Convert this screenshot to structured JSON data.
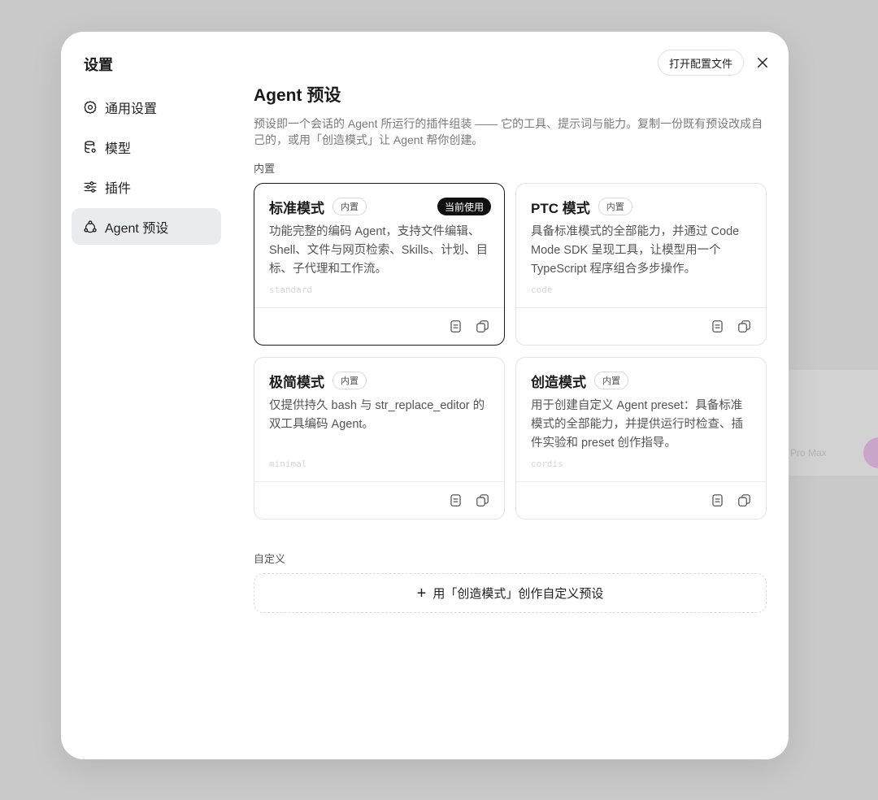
{
  "background": {
    "model_label": "Pro Max"
  },
  "sidebar": {
    "title": "设置",
    "items": [
      {
        "label": "通用设置",
        "icon": "gear-icon",
        "active": false
      },
      {
        "label": "模型",
        "icon": "database-icon",
        "active": false
      },
      {
        "label": "插件",
        "icon": "sliders-icon",
        "active": false
      },
      {
        "label": "Agent 预设",
        "icon": "agent-icon",
        "active": true
      }
    ]
  },
  "header": {
    "open_config_label": "打开配置文件",
    "close_icon": "close-icon"
  },
  "main": {
    "title": "Agent 预设",
    "description": "预设即一个会话的 Agent 所运行的插件组装 —— 它的工具、提示词与能力。复制一份既有预设改成自己的，或用「创造模式」让 Agent 帮你创建。",
    "builtin_label": "内置",
    "custom_label": "自定义",
    "create_button_label": "用「创造模式」创作自定义预设",
    "presets": [
      {
        "title": "标准模式",
        "tag": "内置",
        "badge": "当前使用",
        "description": "功能完整的编码 Agent，支持文件编辑、Shell、文件与网页检索、Skills、计划、目标、子代理和工作流。",
        "id": "standard",
        "active": true
      },
      {
        "title": "PTC 模式",
        "tag": "内置",
        "description": "具备标准模式的全部能力，并通过 Code Mode SDK 呈现工具，让模型用一个 TypeScript 程序组合多步操作。",
        "id": "code",
        "active": false
      },
      {
        "title": "极简模式",
        "tag": "内置",
        "description": "仅提供持久 bash 与 str_replace_editor 的双工具编码 Agent。",
        "id": "minimal",
        "active": false
      },
      {
        "title": "创造模式",
        "tag": "内置",
        "description": "用于创建自定义 Agent preset：具备标准模式的全部能力，并提供运行时检查、插件实验和 preset 创作指导。",
        "id": "cordis",
        "active": false
      }
    ]
  }
}
